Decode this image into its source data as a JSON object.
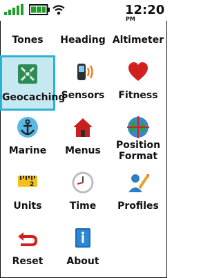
{
  "status": {
    "time": "12:20",
    "ampm": "PM",
    "icons": [
      "signal-icon",
      "battery-icon",
      "wifi-icon"
    ]
  },
  "menu": [
    {
      "label": "Tones",
      "icon": "tones-icon"
    },
    {
      "label": "Heading",
      "icon": "heading-icon"
    },
    {
      "label": "Altimeter",
      "icon": "altimeter-icon"
    },
    {
      "label": "Geocaching",
      "icon": "geocaching-icon",
      "selected": true
    },
    {
      "label": "Sensors",
      "icon": "sensors-icon"
    },
    {
      "label": "Fitness",
      "icon": "fitness-icon"
    },
    {
      "label": "Marine",
      "icon": "marine-icon"
    },
    {
      "label": "Menus",
      "icon": "menus-icon"
    },
    {
      "label_line1": "Position",
      "label_line2": "Format",
      "icon": "position-format-icon"
    },
    {
      "label": "Units",
      "icon": "units-icon"
    },
    {
      "label": "Time",
      "icon": "time-icon"
    },
    {
      "label": "Profiles",
      "icon": "profiles-icon"
    },
    {
      "label": "Reset",
      "icon": "reset-icon"
    },
    {
      "label": "About",
      "icon": "about-icon"
    }
  ],
  "colors": {
    "selected_bg": "#c6e8f0",
    "selected_border": "#29b4d6",
    "signal_green": "#1f9e2c",
    "heart_red": "#d21f1f"
  }
}
